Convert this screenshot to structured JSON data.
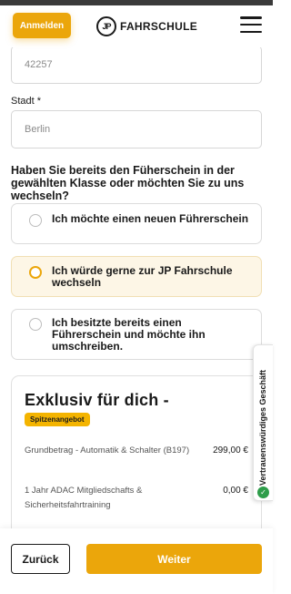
{
  "header": {
    "login_label": "Anmelden",
    "logo_mark": "JP",
    "logo_text": "FAHRSCHULE"
  },
  "form": {
    "zip_value": "42257",
    "city_label": "Stadt *",
    "city_value": "Berlin"
  },
  "question": "Haben Sie bereits den Füherschein in der gewählten Klasse oder möchten Sie zu uns wechseln?",
  "options": [
    {
      "label": "Ich möchte einen neuen Führerschein",
      "selected": false
    },
    {
      "label": "Ich würde gerne zur JP Fahrschule wechseln",
      "selected": true
    },
    {
      "label": "Ich besitzte bereits einen Führerschein und möchte ihn umschreiben.",
      "selected": false
    }
  ],
  "offer": {
    "title": "Exklusiv für dich -",
    "badge": "Spitzenangebot",
    "lines": [
      {
        "label": "Grundbetrag - Automatik & Schalter (B197)",
        "price": "299,00 €"
      },
      {
        "label": "1 Jahr ADAC Mitgliedschafts & Sicherheitsfahrtraining",
        "price": "0,00 €"
      }
    ]
  },
  "trust_badge": "Vertrauenswürdiges Geschäft",
  "footer": {
    "back_label": "Zurück",
    "next_label": "Weiter"
  },
  "colors": {
    "accent": "#eba60b",
    "badge": "#f4b400",
    "selected_bg": "#fdf6e6",
    "trust_green": "#2e9d4a"
  }
}
